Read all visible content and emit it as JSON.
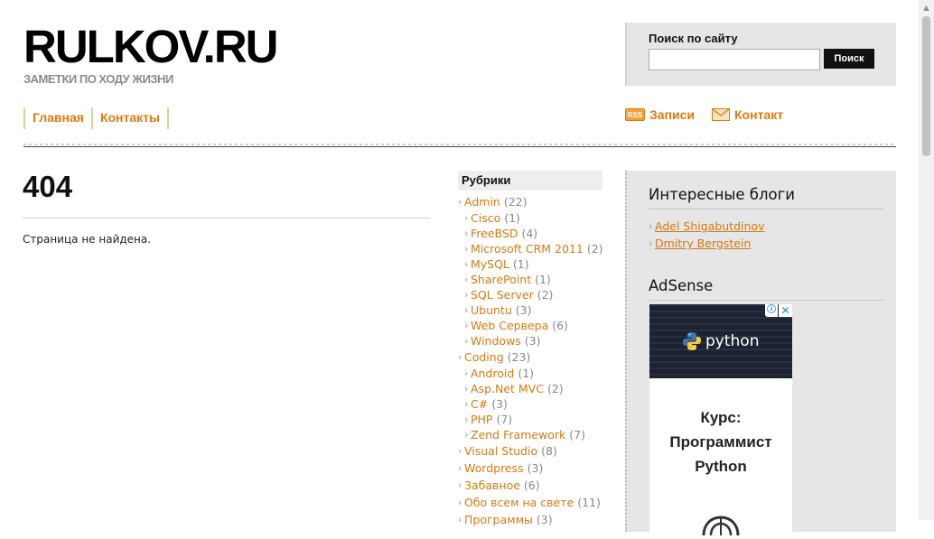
{
  "site": {
    "logo": "RULKOV.RU",
    "tagline": "ЗАМЕТКИ ПО ХОДУ ЖИЗНИ"
  },
  "search": {
    "label": "Поиск по сайту",
    "value": "",
    "button_label": "Поиск"
  },
  "nav": {
    "items": [
      {
        "label": "Главная"
      },
      {
        "label": "Контакты"
      }
    ]
  },
  "feeds": {
    "rss_icon": "RSS",
    "posts_label": "Записи",
    "contact_label": "Контакт",
    "icons": [
      "rss-icon",
      "mail-icon"
    ]
  },
  "content": {
    "title": "404",
    "message": "Страница не найдена."
  },
  "rubrics": {
    "title": "Рубрики",
    "items": [
      {
        "name": "Admin",
        "count": "(22)",
        "level": 0
      },
      {
        "name": "Cisco",
        "count": "(1)",
        "level": 1
      },
      {
        "name": "FreeBSD",
        "count": "(4)",
        "level": 1
      },
      {
        "name": "Microsoft CRM 2011",
        "count": "(2)",
        "level": 1
      },
      {
        "name": "MySQL",
        "count": "(1)",
        "level": 1
      },
      {
        "name": "SharePoint",
        "count": "(1)",
        "level": 1
      },
      {
        "name": "SQL Server",
        "count": "(2)",
        "level": 1
      },
      {
        "name": "Ubuntu",
        "count": "(3)",
        "level": 1
      },
      {
        "name": "Web Сервера",
        "count": "(6)",
        "level": 1
      },
      {
        "name": "Windows",
        "count": "(3)",
        "level": 1
      },
      {
        "name": "Coding",
        "count": "(23)",
        "level": 0
      },
      {
        "name": "Android",
        "count": "(1)",
        "level": 1
      },
      {
        "name": "Asp.Net MVC",
        "count": "(2)",
        "level": 1
      },
      {
        "name": "C#",
        "count": "(3)",
        "level": 1
      },
      {
        "name": "PHP",
        "count": "(7)",
        "level": 1
      },
      {
        "name": "Zend Framework",
        "count": "(7)",
        "level": 1
      },
      {
        "name": "Visual Studio",
        "count": "(8)",
        "level": 0
      },
      {
        "name": "Wordpress",
        "count": "(3)",
        "level": 0
      },
      {
        "name": "Забавное",
        "count": "(6)",
        "level": 0
      },
      {
        "name": "Обо всем на свете",
        "count": "(11)",
        "level": 0
      },
      {
        "name": "Программы",
        "count": "(3)",
        "level": 0
      }
    ]
  },
  "sidebar": {
    "blogs_title": "Интересные блоги",
    "blogs": [
      {
        "label": "Adel Shigabutdinov"
      },
      {
        "label": "Dmitry Bergstein"
      }
    ],
    "adsense_title": "AdSense",
    "ad": {
      "logo_text": "python",
      "info_icon": "ⓘ",
      "close_icon": "✕",
      "course_lines": [
        "Курс:",
        "Программист",
        "Python"
      ]
    }
  },
  "colors": {
    "accent": "#e07a10",
    "link": "#d47a12",
    "sidebar_bg": "#e6e6e6"
  }
}
